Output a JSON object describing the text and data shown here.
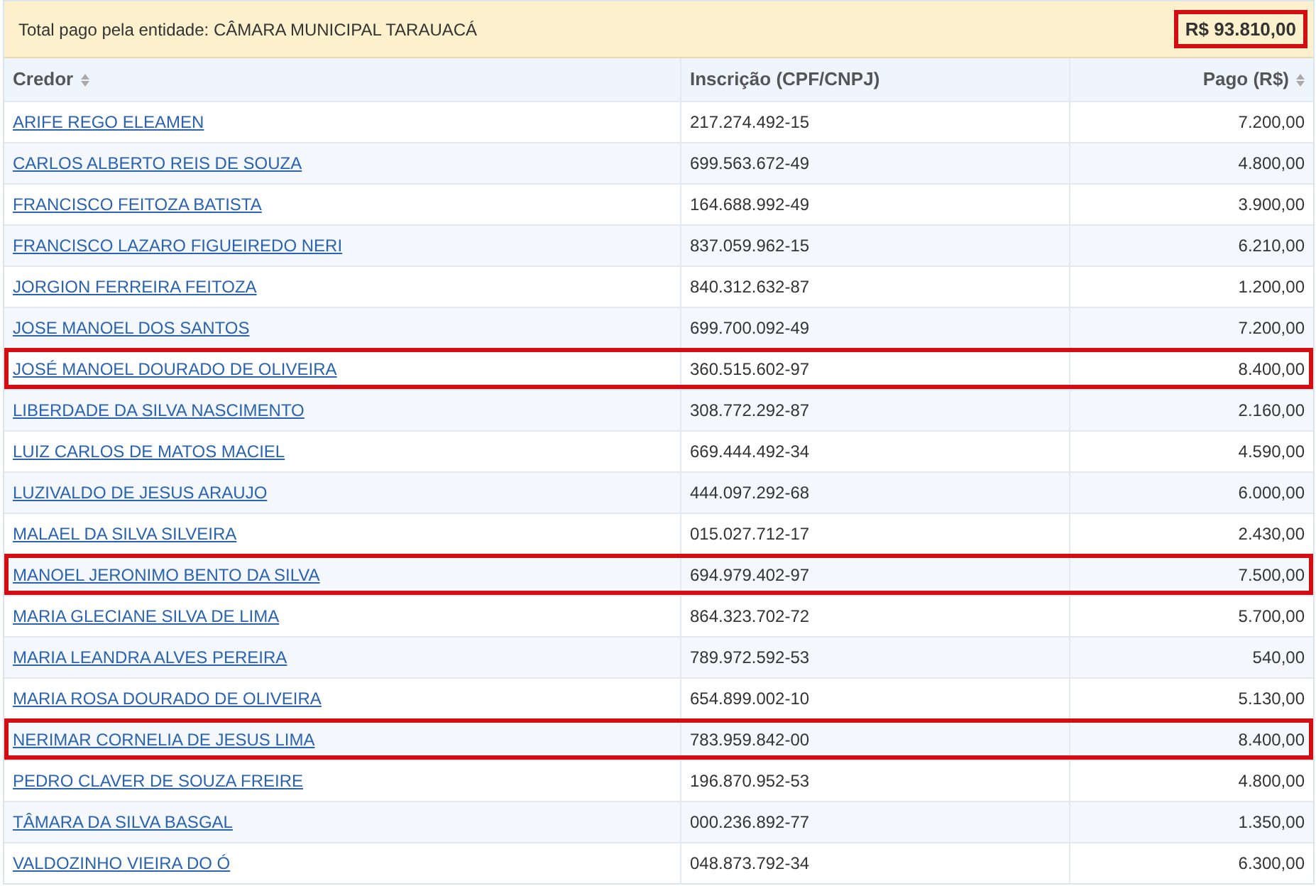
{
  "summary": {
    "label": "Total pago pela entidade: CÂMARA MUNICIPAL TARAUACÁ",
    "total": "R$ 93.810,00",
    "highlighted": true
  },
  "table": {
    "columns": [
      {
        "label": "Credor",
        "sortable": true
      },
      {
        "label": "Inscrição (CPF/CNPJ)",
        "sortable": false
      },
      {
        "label": "Pago (R$)",
        "sortable": true
      }
    ],
    "rows": [
      {
        "credor": "ARIFE REGO ELEAMEN",
        "inscricao": "217.274.492-15",
        "pago": "7.200,00",
        "highlighted": false
      },
      {
        "credor": "CARLOS ALBERTO REIS DE SOUZA",
        "inscricao": "699.563.672-49",
        "pago": "4.800,00",
        "highlighted": false
      },
      {
        "credor": "FRANCISCO FEITOZA BATISTA",
        "inscricao": "164.688.992-49",
        "pago": "3.900,00",
        "highlighted": false
      },
      {
        "credor": "FRANCISCO LAZARO FIGUEIREDO NERI",
        "inscricao": "837.059.962-15",
        "pago": "6.210,00",
        "highlighted": false
      },
      {
        "credor": "JORGION FERREIRA FEITOZA",
        "inscricao": "840.312.632-87",
        "pago": "1.200,00",
        "highlighted": false
      },
      {
        "credor": "JOSE MANOEL DOS SANTOS",
        "inscricao": "699.700.092-49",
        "pago": "7.200,00",
        "highlighted": false
      },
      {
        "credor": "JOSÉ MANOEL DOURADO DE OLIVEIRA",
        "inscricao": "360.515.602-97",
        "pago": "8.400,00",
        "highlighted": true
      },
      {
        "credor": "LIBERDADE DA SILVA NASCIMENTO",
        "inscricao": "308.772.292-87",
        "pago": "2.160,00",
        "highlighted": false
      },
      {
        "credor": "LUIZ CARLOS DE MATOS MACIEL",
        "inscricao": "669.444.492-34",
        "pago": "4.590,00",
        "highlighted": false
      },
      {
        "credor": "LUZIVALDO DE JESUS ARAUJO",
        "inscricao": "444.097.292-68",
        "pago": "6.000,00",
        "highlighted": false
      },
      {
        "credor": "MALAEL DA SILVA SILVEIRA",
        "inscricao": "015.027.712-17",
        "pago": "2.430,00",
        "highlighted": false
      },
      {
        "credor": "MANOEL JERONIMO BENTO DA SILVA",
        "inscricao": "694.979.402-97",
        "pago": "7.500,00",
        "highlighted": true
      },
      {
        "credor": "MARIA GLECIANE SILVA DE LIMA",
        "inscricao": "864.323.702-72",
        "pago": "5.700,00",
        "highlighted": false
      },
      {
        "credor": "MARIA LEANDRA ALVES PEREIRA",
        "inscricao": "789.972.592-53",
        "pago": "540,00",
        "highlighted": false
      },
      {
        "credor": "MARIA ROSA DOURADO DE OLIVEIRA",
        "inscricao": "654.899.002-10",
        "pago": "5.130,00",
        "highlighted": false
      },
      {
        "credor": "NERIMAR CORNELIA DE JESUS LIMA",
        "inscricao": "783.959.842-00",
        "pago": "8.400,00",
        "highlighted": true
      },
      {
        "credor": "PEDRO CLAVER DE SOUZA FREIRE",
        "inscricao": "196.870.952-53",
        "pago": "4.800,00",
        "highlighted": false
      },
      {
        "credor": "TÂMARA DA SILVA BASGAL",
        "inscricao": "000.236.892-77",
        "pago": "1.350,00",
        "highlighted": false
      },
      {
        "credor": "VALDOZINHO VIEIRA DO Ó",
        "inscricao": "048.873.792-34",
        "pago": "6.300,00",
        "highlighted": false
      }
    ]
  }
}
